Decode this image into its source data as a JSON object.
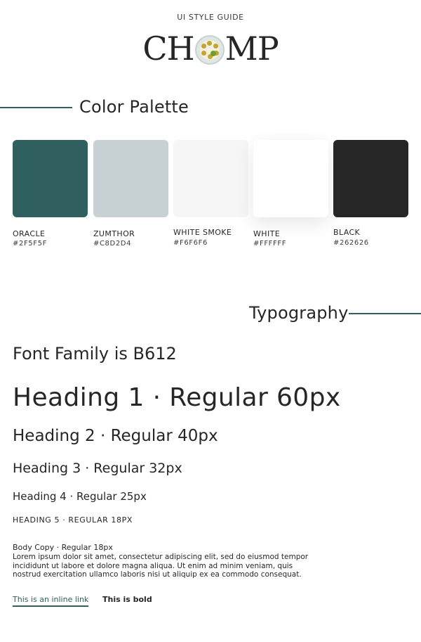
{
  "header": {
    "eyebrow": "UI STYLE GUIDE",
    "logo_left": "CH",
    "logo_right": "MP",
    "logo_icon": "plate-of-food-icon"
  },
  "color_palette": {
    "title": "Color Palette",
    "accent_rule_color": "#2F5F5F",
    "swatches": [
      {
        "name": "ORACLE",
        "hex": "#2F5F5F",
        "color": "#2F5F5F"
      },
      {
        "name": "ZUMTHOR",
        "hex": "#C8D2D4",
        "color": "#C8D2D4"
      },
      {
        "name": "WHITE SMOKE",
        "hex": "#F6F6F6",
        "color": "#F6F6F6"
      },
      {
        "name": "WHITE",
        "hex": "#FFFFFF",
        "color": "#FFFFFF"
      },
      {
        "name": "BLACK",
        "hex": "#262626",
        "color": "#262626"
      }
    ]
  },
  "typography": {
    "title": "Typography",
    "font_family": "Font Family is B612",
    "h1": "Heading 1 · Regular 60px",
    "h2": "Heading 2 · Regular 40px",
    "h3": "Heading 3 · Regular 32px",
    "h4": "Heading 4 · Regular 25px",
    "h5": "HEADING 5 · REGULAR 18PX",
    "body_title": "Body Copy · Regular 18px",
    "body_copy": "Lorem ipsum dolor sit amet, consectetur adipiscing elit, sed do eiusmod tempor incididunt ut labore et dolore magna aliqua. Ut enim ad minim veniam, quis nostrud exercitation ullamco laboris nisi ut aliquip ex ea commodo consequat.",
    "link_text": "This is an inline link",
    "bold_text": "This is bold"
  }
}
